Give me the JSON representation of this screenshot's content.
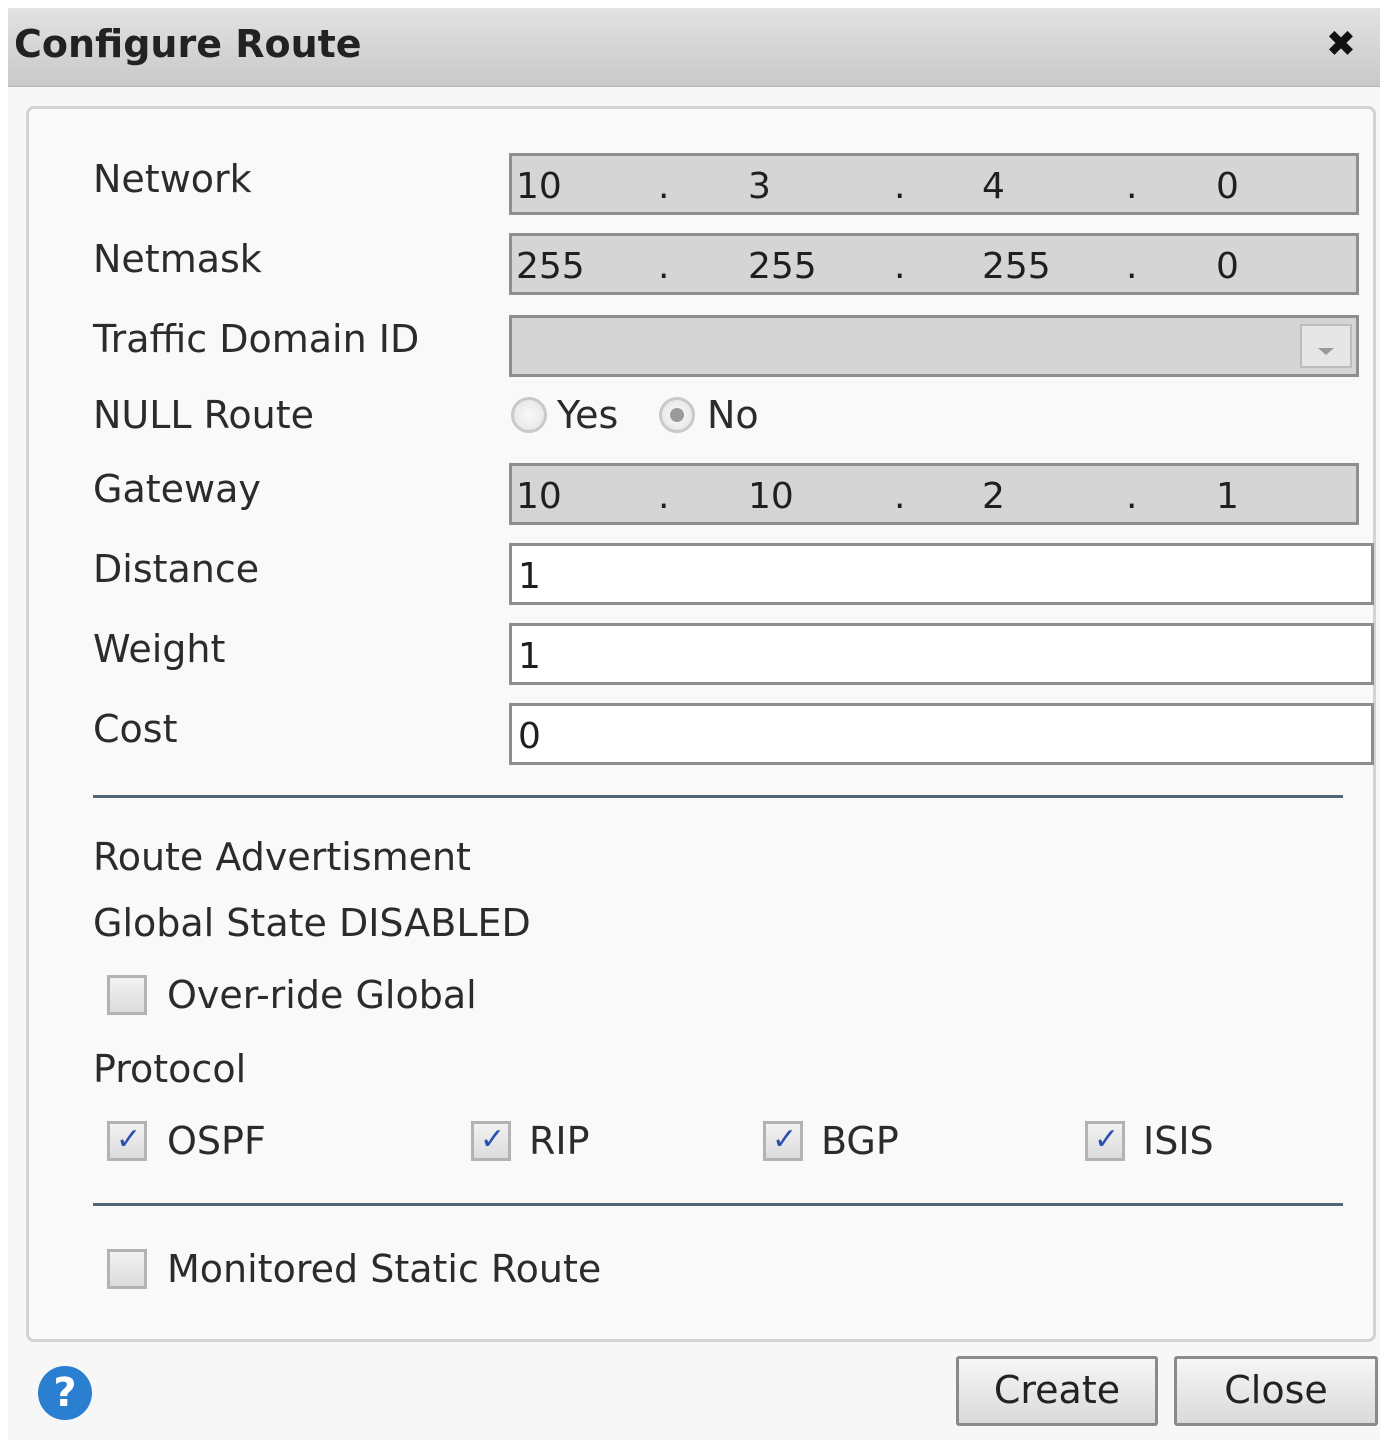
{
  "dialog": {
    "title": "Configure Route",
    "close_glyph": "✖"
  },
  "fields": {
    "network": {
      "label": "Network",
      "octets": [
        "10",
        "3",
        "4",
        "0"
      ]
    },
    "netmask": {
      "label": "Netmask",
      "octets": [
        "255",
        "255",
        "255",
        "0"
      ]
    },
    "traffic_domain": {
      "label": "Traffic Domain ID",
      "value": ""
    },
    "null_route": {
      "label": "NULL Route",
      "options": [
        "Yes",
        "No"
      ],
      "selected": "No"
    },
    "gateway": {
      "label": "Gateway",
      "octets": [
        "10",
        "10",
        "2",
        "1"
      ]
    },
    "distance": {
      "label": "Distance",
      "value": "1"
    },
    "weight": {
      "label": "Weight",
      "value": "1"
    },
    "cost": {
      "label": "Cost",
      "value": "0"
    }
  },
  "route_advertisment": {
    "heading": "Route Advertisment",
    "global_state": "Global State DISABLED",
    "override": {
      "label": "Over-ride Global",
      "checked": false
    },
    "protocol_heading": "Protocol",
    "protocols": [
      {
        "label": "OSPF",
        "checked": true
      },
      {
        "label": "RIP",
        "checked": true
      },
      {
        "label": "BGP",
        "checked": true
      },
      {
        "label": "ISIS",
        "checked": true
      }
    ]
  },
  "monitored": {
    "label": "Monitored Static Route",
    "checked": false
  },
  "footer": {
    "help_glyph": "?",
    "create_label": "Create",
    "close_label": "Close"
  },
  "colors": {
    "separator": "#4f6779",
    "help_icon": "#2b7fd0",
    "checkmark": "#2a4fb0"
  }
}
